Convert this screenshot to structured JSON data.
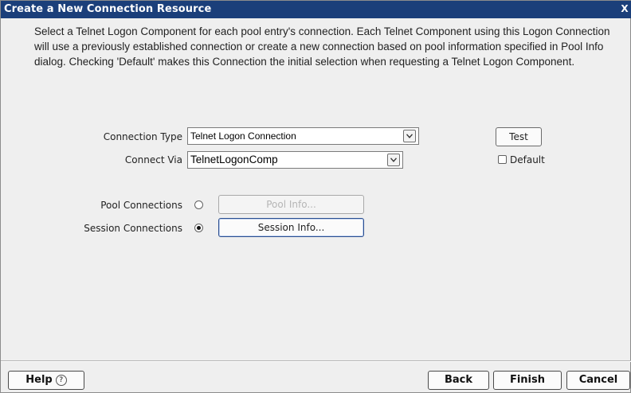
{
  "window": {
    "title": "Create a New Connection Resource",
    "close_label": "X"
  },
  "description": "Select a Telnet Logon Component for each pool entry's connection. Each Telnet Component using this Logon Connection will use a previously established connection or create a new connection based on pool information specified in Pool Info dialog. Checking 'Default' makes this Connection the initial selection when requesting a Telnet Logon Component.",
  "form": {
    "connection_type_label": "Connection Type",
    "connection_type_value": "Telnet Logon Connection",
    "connect_via_label": "Connect Via",
    "connect_via_value": "TelnetLogonComp",
    "test_button": "Test",
    "default_label": "Default",
    "default_checked": false,
    "pool_connections_label": "Pool Connections",
    "pool_connections_selected": false,
    "pool_info_button": "Pool Info...",
    "session_connections_label": "Session Connections",
    "session_connections_selected": true,
    "session_info_button": "Session Info..."
  },
  "footer": {
    "help_button": "Help",
    "back_button": "Back",
    "finish_button": "Finish",
    "cancel_button": "Cancel"
  },
  "icons": {
    "close": "close-icon",
    "dropdown": "chevron-down-icon",
    "help": "help-circle-icon"
  },
  "colors": {
    "titlebar": "#1b3f7a",
    "background": "#efefef"
  }
}
